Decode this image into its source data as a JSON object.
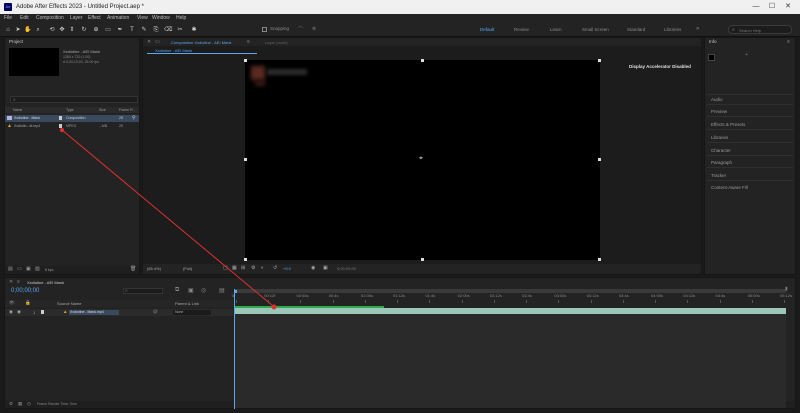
{
  "app": {
    "title": "Adobe After Effects 2023 - Untitled Project.aep *",
    "icon_text": "Ae",
    "window_controls": [
      "—",
      "☐",
      "✕"
    ]
  },
  "menu": [
    "File",
    "Edit",
    "Composition",
    "Layer",
    "Effect",
    "Animation",
    "View",
    "Window",
    "Help"
  ],
  "toolbar": {
    "tools": [
      "home-icon",
      "selection-icon",
      "hand-icon",
      "zoom-icon",
      "orbit-icon",
      "pan-icon",
      "dolly-icon",
      "rotate-icon",
      "pan-behind-icon",
      "rectangle-icon",
      "pen-icon",
      "type-icon",
      "brush-icon",
      "clone-icon",
      "eraser-icon",
      "roto-icon",
      "puppet-icon"
    ],
    "snapping_label": "Snapping",
    "workspaces": [
      "Default",
      "Review",
      "Learn",
      "Small Screen",
      "Standard",
      "Libraries"
    ],
    "search_placeholder": "Search Help"
  },
  "project": {
    "title": "Project",
    "footage_name": "Xxdiotine - AEI Mank",
    "footage_info": [
      "1280 x 720 (1.00)",
      "Δ 0;00;10;00, 25.00 fps"
    ],
    "columns": [
      "Name",
      "Type",
      "Size",
      "Frame R..."
    ],
    "items": [
      {
        "name": "Xxdiotine - Mank",
        "type": "Composition",
        "size": "",
        "fps": "25"
      },
      {
        "name": "Xxdiotin...dt.mp4",
        "type": "MPEG",
        "size": "...MB",
        "fps": "25"
      }
    ],
    "footer_bpc": "8 bpc"
  },
  "composition": {
    "tab_label": "Composition Xxdiotine - AEI Mank",
    "subtab_label": "Xxdiotine - AEI Mank",
    "layer_label": "Layer (none)",
    "message": "Display Accelerator Disabled",
    "zoom": "(65.4%)",
    "resolution": "(Full)",
    "timecode": "0;00;00;00",
    "exposure": "+0.0"
  },
  "right_panels": {
    "info_title": "Info",
    "items": [
      "Audio",
      "Preview",
      "Effects & Presets",
      "Libraries",
      "Character",
      "Paragraph",
      "Tracker",
      "Content-Aware Fill"
    ]
  },
  "timeline": {
    "tab_label": "Xxdiotine - AEI Mank",
    "timecode": "0;00;00;00",
    "columns": [
      "Source Name",
      "Parent & Link"
    ],
    "layer": {
      "index": "1",
      "name": "Xxdiotine - Mank.mp4",
      "parent": "None"
    },
    "ruler": [
      "0f",
      "00:12f",
      "00:00s",
      "00:4s",
      "01:00s",
      "01:12s",
      "01:4s",
      "02:00s",
      "02:12s",
      "02:4s",
      "03:00s",
      "03:12s",
      "03:4s",
      "04:00s",
      "04:12s",
      "04:4s",
      "05:00s",
      "05:12s"
    ],
    "footer": "Frame Render Time: 0ms"
  },
  "colors": {
    "accent": "#5aa8f0",
    "workarea_green": "#2fa84f",
    "layer_bar": "#9bc7b8",
    "annotation_red": "#e03030"
  }
}
